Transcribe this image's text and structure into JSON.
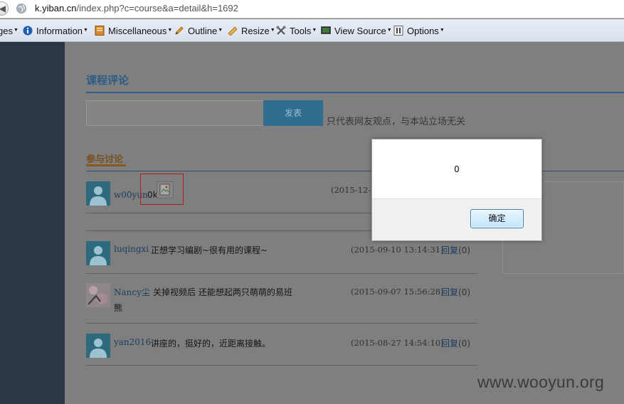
{
  "browser": {
    "url_domain": "k.yiban.cn",
    "url_path": "/index.php?c=course&a=detail&h=1692"
  },
  "toolbar": {
    "items": [
      {
        "label": "ges",
        "icon": "images-menu-icon"
      },
      {
        "label": "Information",
        "icon": "information-icon"
      },
      {
        "label": "Miscellaneous",
        "icon": "miscellaneous-icon"
      },
      {
        "label": "Outline",
        "icon": "pencil-icon"
      },
      {
        "label": "Resize",
        "icon": "ruler-icon"
      },
      {
        "label": "Tools",
        "icon": "tools-icon"
      },
      {
        "label": "View Source",
        "icon": "monitor-icon"
      },
      {
        "label": "Options",
        "icon": "options-icon"
      }
    ]
  },
  "page": {
    "section_title": "课程评论",
    "submit_label": "发表",
    "disclaimer": "只代表网友观点，与本站立场无关",
    "tab_title": "参与讨论"
  },
  "comments": [
    {
      "user": "w00yun",
      "text": "0k",
      "time": "(2015-12-2",
      "reply": "",
      "reply_count": ""
    },
    {
      "user": "luqingxi",
      "text": "正想学习编剧~很有用的课程~",
      "time": "(2015-09-10 13:14:31)",
      "reply": "回复",
      "reply_count": "(0)"
    },
    {
      "user": "Nancy尘",
      "text": "关掉视频后 还能想起两只萌萌的易班",
      "text_wrap": "熊",
      "time": "(2015-09-07 15:56:28)",
      "reply": "回复",
      "reply_count": "(0)"
    },
    {
      "user": "yan2016",
      "text": "讲座的，挺好的，近距离接触。",
      "time": "(2015-08-27 14:54:10)",
      "reply": "回复",
      "reply_count": "(0)"
    }
  ],
  "dialog": {
    "message": "0",
    "ok_label": "确定"
  },
  "watermark": "www.wooyun.org",
  "colors": {
    "accent": "#2f6c8e",
    "dialog_button": "#bee6fd",
    "xss_highlight": "#b51c1c"
  }
}
